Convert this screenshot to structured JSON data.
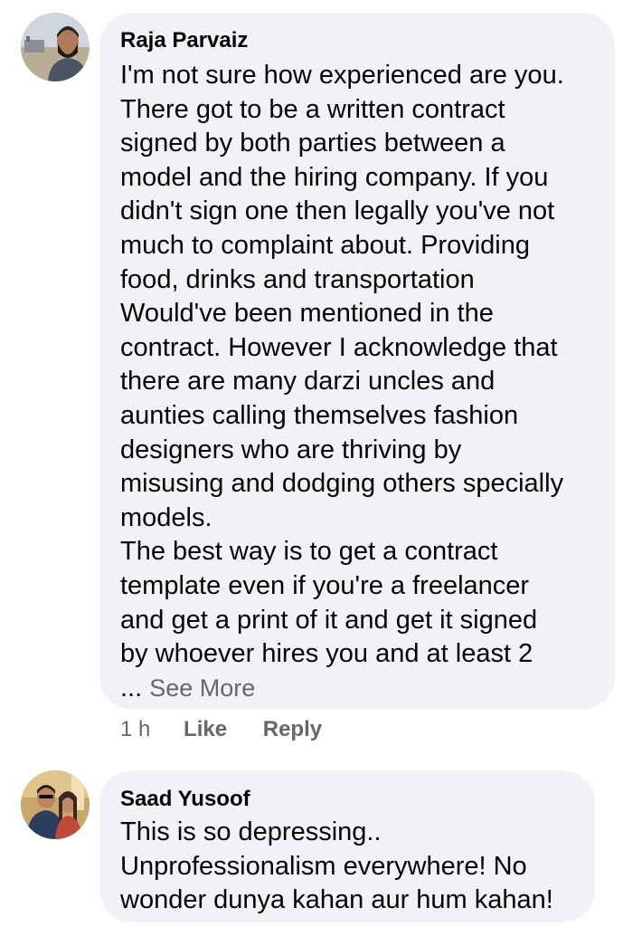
{
  "comments": [
    {
      "author": "Raja Parvaiz",
      "lines": [
        "I'm not sure how experienced are you.",
        "There got to be a written contract",
        "signed by both parties between a",
        "model and the hiring company. If you",
        "didn't sign one then legally you've not",
        "much to complaint about. Providing",
        "food, drinks and transportation",
        "Would've been mentioned in the",
        "contract. However I acknowledge that",
        "there are many darzi uncles and",
        "aunties calling themselves fashion",
        "designers who are thriving by",
        "misusing and dodging others specially",
        "models.",
        "The best way is to get a contract",
        "template even if you're a freelancer",
        "and get a print of it and get it signed",
        "by whoever hires you and at least 2"
      ],
      "ellipsis": "...",
      "see_more": "See More",
      "time": "1 h",
      "like": "Like",
      "reply": "Reply"
    },
    {
      "author": "Saad Yusoof",
      "lines": [
        "This is so depressing..",
        "Unprofessionalism everywhere! No",
        "wonder dunya kahan aur hum kahan!"
      ]
    }
  ]
}
